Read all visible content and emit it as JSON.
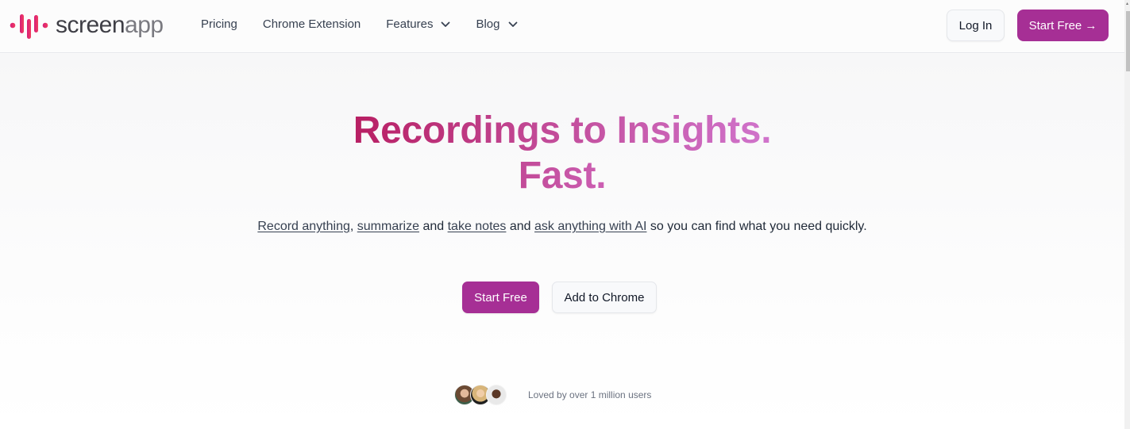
{
  "brand": {
    "name_part1": "screen",
    "name_part2": "app",
    "logo_icon": "audio-wave-icon",
    "colors": {
      "logo_pink": "#e0306d",
      "primary": "#a62f95"
    }
  },
  "nav": {
    "items": [
      {
        "label": "Pricing",
        "has_dropdown": false
      },
      {
        "label": "Chrome Extension",
        "has_dropdown": false
      },
      {
        "label": "Features",
        "has_dropdown": true,
        "icon": "chevron-down-icon"
      },
      {
        "label": "Blog",
        "has_dropdown": true,
        "icon": "chevron-down-icon"
      }
    ],
    "login_label": "Log In",
    "start_free_label": "Start Free →"
  },
  "hero": {
    "headline_line1": "Recordings to Insights.",
    "headline_line2": "Fast.",
    "subtitle": {
      "link1": "Record anything",
      "sep1": ", ",
      "link2": "summarize",
      "sep2": " and ",
      "link3": "take notes",
      "sep3": " and ",
      "link4": "ask anything with AI",
      "tail": " so you can find what you need quickly."
    },
    "primary_cta": "Start Free",
    "secondary_cta": "Add to Chrome",
    "social_proof": "Loved by over 1 million users",
    "avatar_count": 3
  }
}
